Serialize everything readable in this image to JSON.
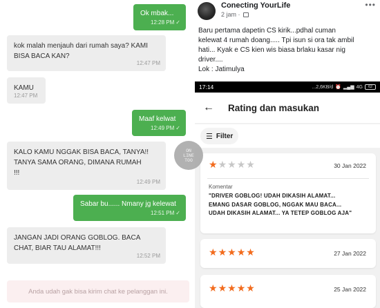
{
  "chat": {
    "messages": [
      {
        "text": "Ok mbak...",
        "time": "12:28 PM",
        "outgoing": true
      },
      {
        "text": "kok malah menjauh dari rumah saya? KAMI\nBISA BACA KAN?",
        "time": "12:47 PM",
        "outgoing": false
      },
      {
        "text": "KAMU",
        "time": "12:47 PM",
        "outgoing": false
      },
      {
        "text": "Maaf kelwat",
        "time": "12:49 PM",
        "outgoing": true
      },
      {
        "text": "KALO KAMU NGGAK BISA BACA, TANYA!!\nTANYA SAMA ORANG, DIMANA RUMAH\n!!!",
        "time": "12:49 PM",
        "outgoing": false
      },
      {
        "text": "Sabar bu...... Nmany jg kelewat",
        "time": "12:51 PM",
        "outgoing": true
      },
      {
        "text": "JANGAN JADI ORANG GOBLOG. BACA\nCHAT, BIAR TAU ALAMAT!!!",
        "time": "12:52 PM",
        "outgoing": false
      }
    ],
    "notice": "Anda udah gak bisa kirim chat ke pelanggan ini.",
    "watermark": "ON\nLINE\nTOO"
  },
  "post": {
    "author": "Conecting YourLife",
    "time": "2 jam ·",
    "text": "Baru pertama dapetin CS kirik...pdhal cuman\nkelewat  4 rumah doang..... Tpi isun si ora tak ambil\nhati... Kyak e CS kien wis biasa brlaku kasar nig\ndriver....\nLok : Jatimulya",
    "more_icon": "more-dots-icon"
  },
  "screenshot": {
    "status_time": "17:14",
    "status_right": "...2,6KB/d",
    "network": "4G",
    "battery": "62",
    "title": "Rating dan masukan",
    "filter_label": "Filter",
    "reviews": [
      {
        "stars": 1,
        "date": "30 Jan 2022",
        "comment_label": "Komentar",
        "comment": "\"DRIVER GOBLOG! UDAH DIKASIH ALAMAT...\nEMANG DASAR GOBLOG, NGGAK MAU BACA...\nUDAH DIKASIH ALAMAT... YA TETEP GOBLOG AJA\""
      },
      {
        "stars": 5,
        "date": "27 Jan 2022"
      },
      {
        "stars": 5,
        "date": "25 Jan 2022"
      }
    ]
  },
  "colors": {
    "outgoing_bubble": "#4caf50",
    "incoming_bubble": "#ededed",
    "star": "#f26b1d",
    "notice_bg": "#fbeff0"
  }
}
